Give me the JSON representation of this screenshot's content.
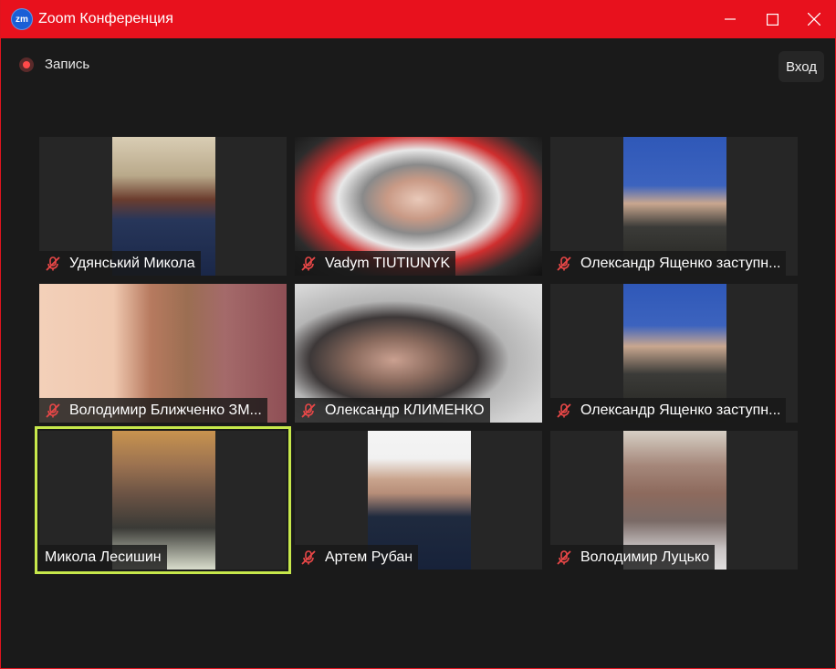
{
  "window": {
    "logo_text": "zm",
    "title": "Zoom Конференция"
  },
  "toolbar": {
    "record_label": "Запись",
    "exit_label": "Вход"
  },
  "colors": {
    "titlebar": "#e8111d",
    "active_speaker": "#c7e84b",
    "mute": "#e84747"
  },
  "participants": [
    {
      "name": "Удянський Микола",
      "muted": true
    },
    {
      "name": "Vadym TIUTIUNYK",
      "muted": true
    },
    {
      "name": "Олександр Ященко заступн...",
      "muted": true
    },
    {
      "name": "Володимир Ближченко ЗМ...",
      "muted": true
    },
    {
      "name": "Олександр КЛИМЕНКО",
      "muted": true
    },
    {
      "name": "Олександр Ященко заступн...",
      "muted": true
    },
    {
      "name": "Микола Лесишин",
      "muted": false,
      "active": true
    },
    {
      "name": "Артем Рубан",
      "muted": true
    },
    {
      "name": "Володимир Луцько",
      "muted": true
    }
  ]
}
